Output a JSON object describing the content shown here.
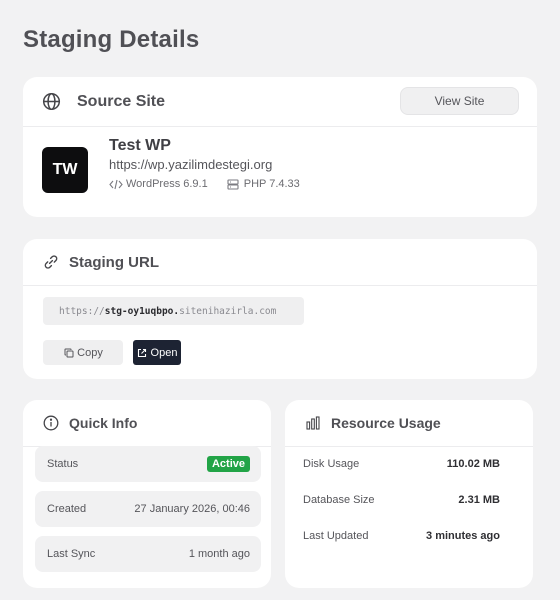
{
  "page": {
    "title": "Staging Details"
  },
  "source_site": {
    "heading": "Source Site",
    "icon": "globe-icon",
    "view_button": "View Site",
    "logo_text": "TW",
    "site_name": "Test WP",
    "site_url": "https://wp.yazilimdestegi.org",
    "wordpress": "WordPress 6.9.1",
    "php": "PHP 7.4.33"
  },
  "staging_url": {
    "heading": "Staging URL",
    "icon": "link-icon",
    "scheme": "https://",
    "subdomain": "stg-oy1uqbpo.",
    "domain": "sitenihazirla.com",
    "copy_label": "Copy",
    "open_label": "Open"
  },
  "quick_info": {
    "heading": "Quick Info",
    "icon": "info-icon",
    "rows": [
      {
        "label": "Status",
        "value": "Active"
      },
      {
        "label": "Created",
        "value": "27 January 2026, 00:46"
      },
      {
        "label": "Last Sync",
        "value": "1 month ago"
      }
    ],
    "status_color": "#22a447"
  },
  "resource_usage": {
    "heading": "Resource Usage",
    "icon": "bar-chart-icon",
    "rows": [
      {
        "label": "Disk Usage",
        "value": "110.02 MB"
      },
      {
        "label": "Database Size",
        "value": "2.31 MB"
      },
      {
        "label": "Last Updated",
        "value": "3 minutes ago"
      }
    ]
  },
  "colors": {
    "background": "#f2f2f3",
    "open_button": "#1d2333",
    "logo_bg": "#0d0d0f"
  }
}
